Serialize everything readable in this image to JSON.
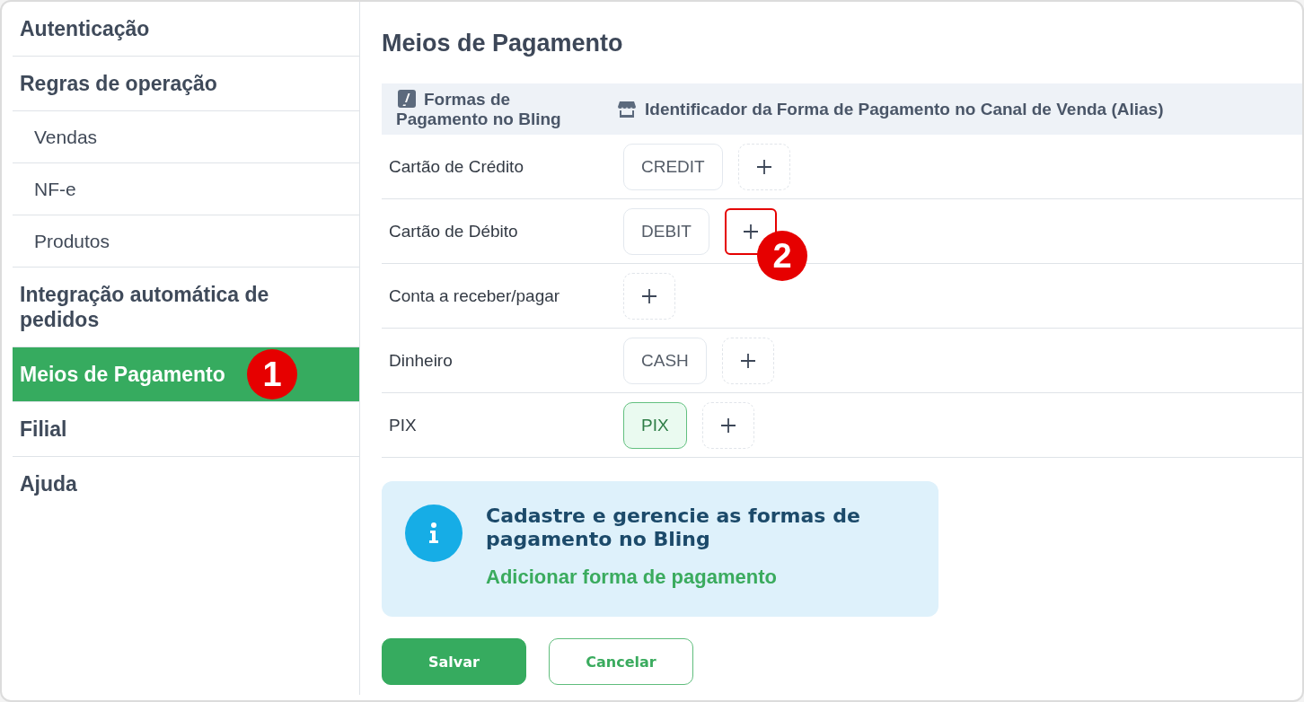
{
  "sidebar": {
    "items": [
      {
        "label": "Autenticação",
        "selected": false
      },
      {
        "label": "Regras de operação",
        "selected": false,
        "children": [
          {
            "label": "Vendas",
            "selected": false
          },
          {
            "label": "NF-e",
            "selected": false
          },
          {
            "label": "Produtos",
            "selected": false
          }
        ]
      },
      {
        "label": "Integração automática de pedidos",
        "selected": false
      },
      {
        "label": "Meios de Pagamento",
        "selected": true,
        "marker": "1"
      },
      {
        "label": "Filial",
        "selected": false
      },
      {
        "label": "Ajuda",
        "selected": false
      }
    ]
  },
  "page": {
    "title": "Meios de Pagamento"
  },
  "table": {
    "columns": [
      {
        "label": "Formas de Pagamento no Bling"
      },
      {
        "label": "Identificador da Forma de Pagamento no Canal de Venda (Alias)"
      }
    ],
    "rows": [
      {
        "name": "Cartão de Crédito",
        "aliases": [
          {
            "label": "CREDIT",
            "selected": false
          }
        ],
        "add_button": {
          "highlighted": false
        }
      },
      {
        "name": "Cartão de Débito",
        "aliases": [
          {
            "label": "DEBIT",
            "selected": false
          }
        ],
        "add_button": {
          "highlighted": true,
          "marker": "2"
        }
      },
      {
        "name": "Conta a receber/pagar",
        "add_button": {
          "highlighted": false
        }
      },
      {
        "name": "Dinheiro",
        "aliases": [
          {
            "label": "CASH",
            "selected": false
          }
        ],
        "add_button": {
          "highlighted": false
        }
      },
      {
        "name": "PIX",
        "aliases": [
          {
            "label": "PIX",
            "selected": true
          }
        ],
        "add_button": {
          "highlighted": false
        }
      }
    ]
  },
  "info_box": {
    "title": "Cadastre e gerencie as formas de pagamento no Bling",
    "link": "Adicionar forma de pagamento"
  },
  "buttons": [
    {
      "label": "Salvar",
      "kind": "primary"
    },
    {
      "label": "Cancelar",
      "kind": "secondary"
    }
  ]
}
